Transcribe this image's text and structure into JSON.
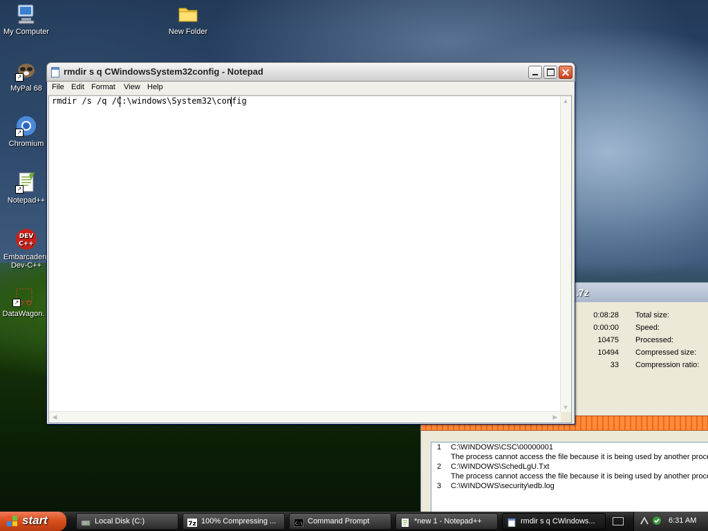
{
  "desktop": {
    "icons": [
      {
        "label": "My Computer"
      },
      {
        "label": "New Folder"
      },
      {
        "label": "MyPal 68"
      },
      {
        "label": "Chromium"
      },
      {
        "label": "Notepad++"
      },
      {
        "label": "Embarcadero\nDev-C++"
      },
      {
        "label": "DataWagon."
      }
    ]
  },
  "zip_window": {
    "title": ".7z",
    "stats_left": [
      {
        "value": "0:08:28",
        "label": "Total size:"
      },
      {
        "value": "0:00:00",
        "label": "Speed:"
      },
      {
        "value": "10475",
        "label": "Processed:"
      },
      {
        "value": "10494",
        "label": "Compressed size:"
      },
      {
        "value": "33",
        "label": "Compression ratio:"
      }
    ],
    "progress_color": "#ff8a3a",
    "log": [
      {
        "num": "1",
        "text": "C:\\WINDOWS\\CSC\\00000001"
      },
      {
        "num": "",
        "text": "The process cannot access the file because it is being used by another process"
      },
      {
        "num": "2",
        "text": "C:\\WINDOWS\\SchedLgU.Txt"
      },
      {
        "num": "",
        "text": "The process cannot access the file because it is being used by another process"
      },
      {
        "num": "3",
        "text": "C:\\WINDOWS\\security\\edb.log"
      }
    ]
  },
  "notepad": {
    "title": "rmdir s q CWindowsSystem32config - Notepad",
    "menu": [
      "File",
      "Edit",
      "Format",
      "View",
      "Help"
    ],
    "content": "rmdir /s /q /C:\\windows\\System32\\config"
  },
  "taskbar": {
    "start_label": "start",
    "buttons": [
      {
        "label": "Local Disk (C:)",
        "icon": "drive-icon"
      },
      {
        "label": "100% Compressing ...",
        "icon": "7zip-icon"
      },
      {
        "label": "Command Prompt",
        "icon": "cmd-icon"
      },
      {
        "label": "*new 1 - Notepad++",
        "icon": "notepadpp-icon"
      },
      {
        "label": "rmdir s q CWindows...",
        "icon": "notepad-icon"
      }
    ],
    "clock": "6:31 AM"
  }
}
